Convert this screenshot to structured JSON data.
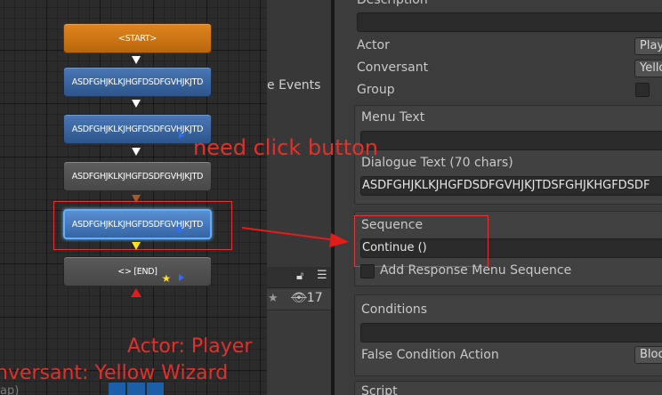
{
  "graph": {
    "nodes": [
      {
        "label": "<START>"
      },
      {
        "label": "ASDFGHJKLKJHGFDSDFGVHJKJTD"
      },
      {
        "label": "ASDFGHJKLKJHGFDSDFGVHJKJTD"
      },
      {
        "label": "ASDFGHJKLKJHGFDSDFGVHJKJTD"
      },
      {
        "label": "ASDFGHJKLKJHGFDSDFGVHJKJTD"
      },
      {
        "label": "<> [END]"
      }
    ],
    "colors": {
      "start": "#d97a14",
      "node": "#3d6aa8",
      "selected_border": "#5fb0ff",
      "annotation": "#e2302b"
    }
  },
  "annotations": {
    "click_note": "need click button",
    "actor_note": "Actor: Player",
    "conversant_note": "nversant: Yellow Wizard",
    "stray_text": "ap)"
  },
  "side_panel": {
    "events_label": "e Events",
    "count": "17"
  },
  "inspector": {
    "description_label": "Description",
    "actor_label": "Actor",
    "actor_value": "Player",
    "conversant_label": "Conversant",
    "conversant_value": "Yellow Wizard",
    "group_label": "Group",
    "menu_text_label": "Menu Text",
    "menu_text_value": "",
    "dialogue_text_label": "Dialogue Text (70 chars)",
    "dialogue_text_value": "ASDFGHJKLKJHGFDSDFGVHJKJTDSFGHJKHGFDSDF",
    "sequence_label": "Sequence",
    "sequence_value": "Continue  ()",
    "add_response_label": "Add Response Menu Sequence",
    "conditions_label": "Conditions",
    "false_condition_label": "False Condition Action",
    "false_condition_value": "Block",
    "script_label": "Script"
  }
}
